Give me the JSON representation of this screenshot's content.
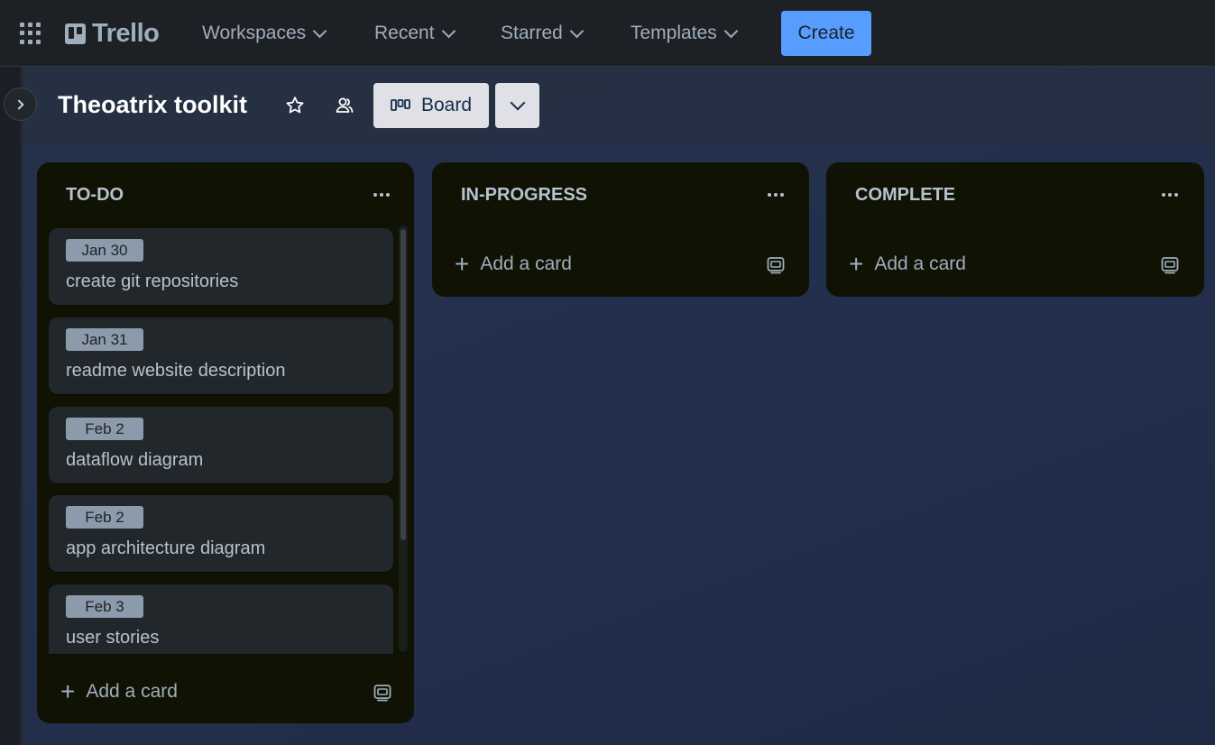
{
  "nav": {
    "brand": "Trello",
    "items": [
      {
        "label": "Workspaces"
      },
      {
        "label": "Recent"
      },
      {
        "label": "Starred"
      },
      {
        "label": "Templates"
      }
    ],
    "create_label": "Create"
  },
  "board": {
    "title": "Theoatrix toolkit",
    "view_label": "Board"
  },
  "lists": [
    {
      "title": "TO-DO",
      "cards": [
        {
          "due": "Jan 30",
          "title": "create git repositories"
        },
        {
          "due": "Jan 31",
          "title": "readme website description"
        },
        {
          "due": "Feb 2",
          "title": "dataflow diagram"
        },
        {
          "due": "Feb 2",
          "title": "app architecture diagram"
        },
        {
          "due": "Feb 3",
          "title": "user stories"
        }
      ],
      "add_label": "Add a card"
    },
    {
      "title": "IN-PROGRESS",
      "cards": [],
      "add_label": "Add a card"
    },
    {
      "title": "COMPLETE",
      "cards": [],
      "add_label": "Add a card"
    }
  ],
  "colors": {
    "accent": "#579dff",
    "list_bg": "#101204",
    "card_bg": "#22272b",
    "badge_bg": "#8c9bab"
  },
  "icons": [
    "apps-grid-icon",
    "trello-logo-icon",
    "chevron-down-icon",
    "sidebar-expand-icon",
    "star-icon",
    "people-icon",
    "board-view-icon",
    "more-dots-icon",
    "plus-icon",
    "card-template-icon"
  ]
}
